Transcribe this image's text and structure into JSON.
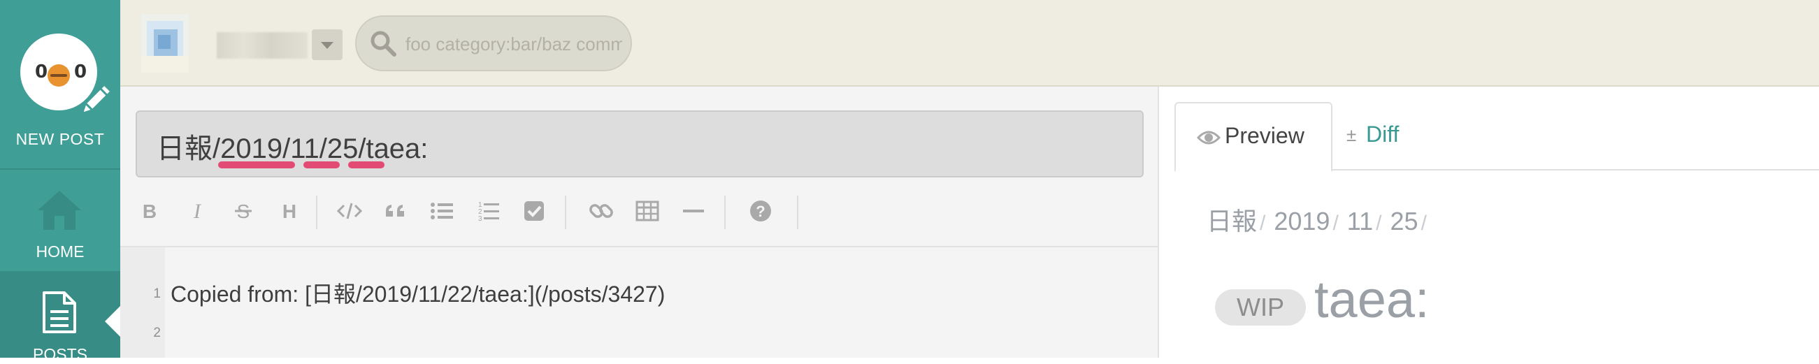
{
  "sidebar": {
    "new_post_label": "NEW POST",
    "items": [
      {
        "label": "HOME",
        "icon": "home-icon"
      },
      {
        "label": "POSTS",
        "icon": "document-icon",
        "active": true
      }
    ]
  },
  "topbar": {
    "search_placeholder": "foo category:bar/baz comment:foobar"
  },
  "editor": {
    "title_value": "日報/2019/11/25/taea:",
    "toolbar": [
      "bold-icon",
      "italic-icon",
      "strikethrough-icon",
      "heading-icon",
      "code-icon",
      "quote-icon",
      "bullet-list-icon",
      "numbered-list-icon",
      "task-list-icon",
      "link-icon",
      "table-icon",
      "horizontal-rule-icon",
      "help-icon"
    ],
    "lines": [
      {
        "number": "1",
        "text": "Copied from: [日報/2019/11/22/taea:](/posts/3427)"
      },
      {
        "number": "2",
        "text": ""
      }
    ]
  },
  "preview": {
    "tabs": {
      "preview_label": "Preview",
      "diff_sign": "±",
      "diff_label": "Diff"
    },
    "category": [
      "日報",
      "2019",
      "11",
      "25"
    ],
    "category_separator": "/",
    "wip_label": "WIP",
    "title": "taea:"
  },
  "colors": {
    "sidebar": "#3f9e96",
    "topbar": "#efede2",
    "accent": "#3a9a92",
    "spellcheck": "#e24b73"
  }
}
